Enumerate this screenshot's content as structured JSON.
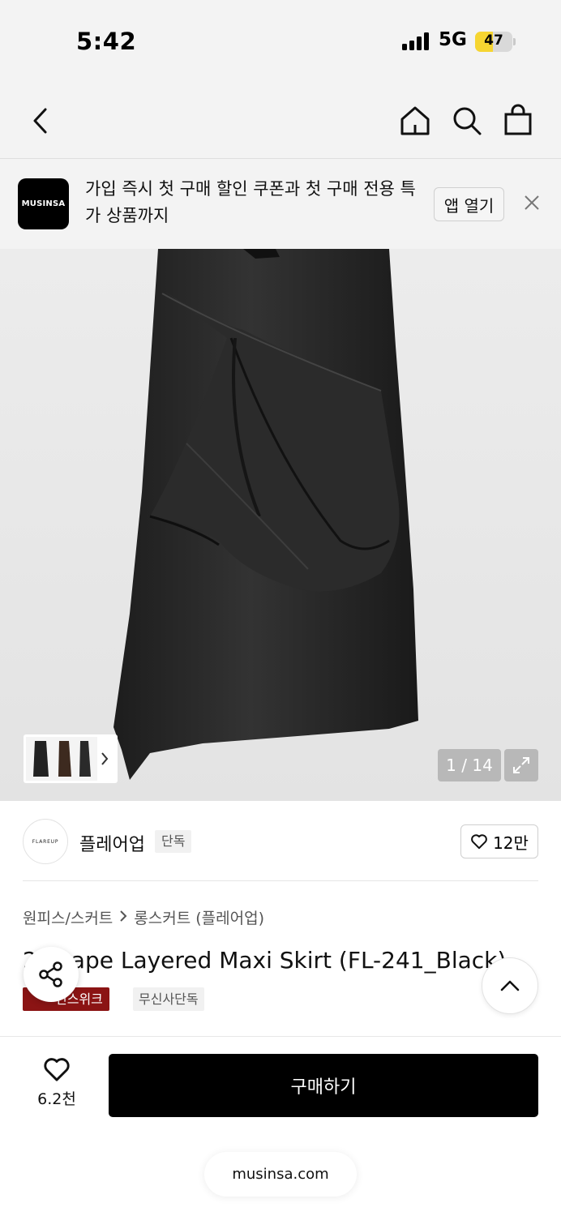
{
  "status_bar": {
    "time": "5:42",
    "network": "5G",
    "battery": "47",
    "battery_level": 0.47
  },
  "nav": {
    "icons": [
      "back-icon",
      "home-icon",
      "search-icon",
      "shopping-bag-icon"
    ]
  },
  "app_banner": {
    "logo_text": "MUSINSA",
    "message": "가입 즉시 첫 구매 할인 쿠폰과 첫 구매 전용 특가 상품까지",
    "open_app_label": "앱 열기"
  },
  "gallery": {
    "counter": "1 / 14",
    "current_image": 1,
    "total_images": 14
  },
  "brand": {
    "logo_text": "FLAREUP",
    "name": "플레어업",
    "badge": "단독",
    "likes": "12만"
  },
  "breadcrumb": {
    "category": "원피스/스커트",
    "subcategory": "롱스커트 (플레어업)"
  },
  "product": {
    "title": "2 Drape Layered Maxi Skirt (FL-241_Black)",
    "tags": [
      "컨스위크",
      "무신사단독"
    ]
  },
  "bottom_bar": {
    "wish_count": "6.2천",
    "buy_label": "구매하기",
    "url": "musinsa.com"
  },
  "colors": {
    "accent_black": "#000000",
    "tag_red": "#8b1414",
    "battery_yellow": "#f6d531"
  }
}
